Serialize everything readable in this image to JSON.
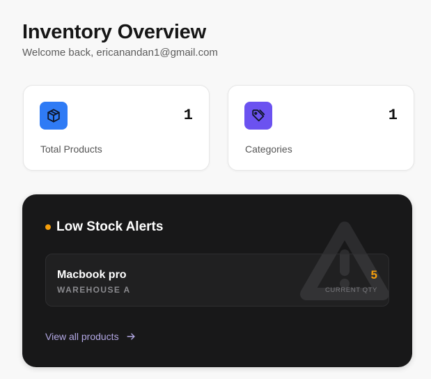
{
  "header": {
    "title": "Inventory Overview",
    "subtitle": "Welcome back, ericanandan1@gmail.com"
  },
  "stats": [
    {
      "label": "Total Products",
      "value": "1",
      "icon": "package-icon",
      "color": "#2f7bf5"
    },
    {
      "label": "Categories",
      "value": "1",
      "icon": "tag-icon",
      "color": "#6b52f0"
    }
  ],
  "low_stock": {
    "title": "Low Stock Alerts",
    "accent": "#f59e0b",
    "watermark_icon": "warning-triangle-icon",
    "items": [
      {
        "name": "Macbook pro",
        "location": "WAREHOUSE A",
        "qty": "5",
        "qty_label": "CURRENT QTY"
      }
    ],
    "view_all_label": "View all products",
    "view_all_icon": "arrow-right-icon"
  }
}
